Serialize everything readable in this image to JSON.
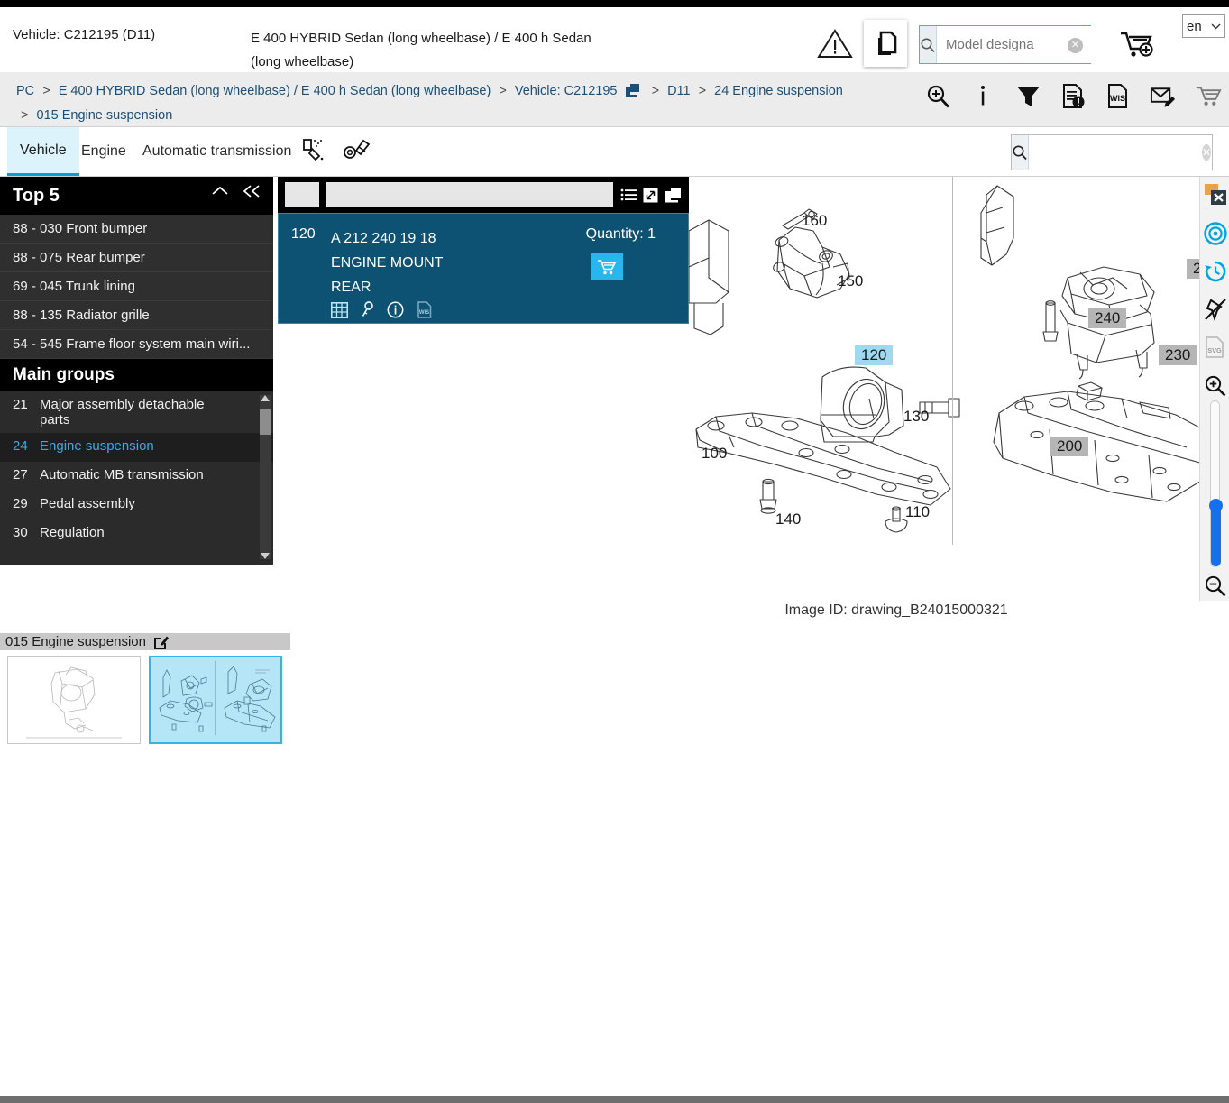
{
  "header": {
    "vehicle_label": "Vehicle: C212195 (D11)",
    "vehicle_model": "E 400 HYBRID Sedan (long wheelbase) / E 400 h Sedan (long wheelbase)",
    "warning_icon": "warning-triangle-icon",
    "copy_icon": "copy-icon",
    "model_search_placeholder": "Model designa",
    "model_search_value": "",
    "search_icon": "search-icon",
    "clear_icon": "clear-icon",
    "cart_icon": "cart-add-icon",
    "language": "en",
    "language_caret": "chevron-down-icon"
  },
  "breadcrumb": {
    "items": [
      "PC",
      "E 400 HYBRID Sedan (long wheelbase) / E 400 h Sedan (long wheelbase)",
      "Vehicle: C212195",
      "D11",
      "24 Engine suspension",
      "015 Engine suspension"
    ],
    "separator": ">",
    "copy_icon": "copy-icon",
    "tools": [
      "zoom-in-icon",
      "info-icon",
      "filter-icon",
      "document-alert-icon",
      "wis-document-icon",
      "mail-edit-icon",
      "cart-icon"
    ]
  },
  "tabs": {
    "items": [
      {
        "label": "Vehicle",
        "active": true
      },
      {
        "label": "Engine",
        "active": false
      },
      {
        "label": "Automatic transmission",
        "active": false
      }
    ],
    "icons": [
      "paint-spray-icon",
      "wheel-bolt-icon"
    ],
    "search_placeholder": "",
    "search_value": "",
    "search_icon": "search-icon",
    "clear_icon": "clear-icon"
  },
  "sidebar": {
    "top5": {
      "title": "Top 5",
      "collapse_icon": "chevron-up-icon",
      "collapse_all_icon": "chevron-double-left-icon",
      "items": [
        "88 - 030 Front bumper",
        "88 - 075 Rear bumper",
        "69 - 045 Trunk lining",
        "88 - 135 Radiator grille",
        "54 - 545 Frame floor system main wiri..."
      ]
    },
    "main_groups": {
      "title": "Main groups",
      "items": [
        {
          "num": "21",
          "label": "Major assembly detachable parts",
          "selected": false
        },
        {
          "num": "24",
          "label": "Engine suspension",
          "selected": true
        },
        {
          "num": "27",
          "label": "Automatic MB transmission",
          "selected": false
        },
        {
          "num": "29",
          "label": "Pedal assembly",
          "selected": false
        },
        {
          "num": "30",
          "label": "Regulation",
          "selected": false
        }
      ],
      "scroll_up_icon": "scroll-up-arrow-icon",
      "scroll_down_icon": "scroll-down-arrow-icon"
    }
  },
  "part_card": {
    "header_icons": [
      "list-icon",
      "expand-icon",
      "copy-icon"
    ],
    "index": "120",
    "part_number": "A 212 240 19 18",
    "name": "ENGINE MOUNT",
    "position": "REAR",
    "quantity_label": "Quantity: 1",
    "cart_icon": "cart-icon",
    "detail_icons": [
      "table-grid-icon",
      "key-icon",
      "info-circle-icon",
      "wis-document-icon"
    ],
    "accent_color": "#0d5272",
    "cart_button_color": "#29b6ec"
  },
  "drawing": {
    "image_id": "Image ID: drawing_B24015000321",
    "callouts_left": [
      {
        "text": "160",
        "style": "plain"
      },
      {
        "text": "150",
        "style": "plain"
      },
      {
        "text": "120",
        "style": "cyan"
      },
      {
        "text": "130",
        "style": "plain"
      },
      {
        "text": "100",
        "style": "plain"
      },
      {
        "text": "140",
        "style": "plain"
      },
      {
        "text": "110",
        "style": "plain"
      }
    ],
    "callouts_right": [
      {
        "text": "2",
        "style": "grey"
      },
      {
        "text": "240",
        "style": "grey"
      },
      {
        "text": "230",
        "style": "grey"
      },
      {
        "text": "200",
        "style": "grey"
      }
    ]
  },
  "view_tools": {
    "items": [
      "close-window-icon",
      "target-icon",
      "history-icon",
      "unpin-icon",
      "svg-export-icon",
      "zoom-in-icon",
      "zoom-slider",
      "zoom-out-icon"
    ],
    "slider_accent": "#1570ef"
  },
  "thumbnails": {
    "title": "015 Engine suspension",
    "edit_icon": "edit-icon",
    "items": [
      {
        "name": "engine-assembly-thumbnail",
        "selected": false
      },
      {
        "name": "engine-suspension-thumbnail",
        "selected": true
      }
    ]
  }
}
